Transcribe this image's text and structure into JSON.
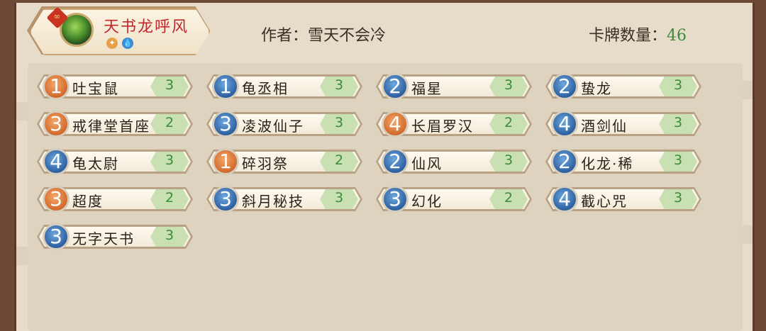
{
  "deck": {
    "name": "天书龙呼风",
    "corner_icon": "link-icon",
    "elements": [
      "fire-element-icon",
      "water-element-icon"
    ]
  },
  "author": {
    "label": "作者：雪天不会冷"
  },
  "card_count": {
    "label": "卡牌数量：",
    "value": "46"
  },
  "colors": {
    "cost_orange": "#d06a2c",
    "cost_blue": "#2d5f9f",
    "count_green": "#3d8a3a",
    "deck_name_red": "#c0282c"
  },
  "cards": [
    {
      "cost": "1",
      "color": "orange",
      "name": "吐宝鼠",
      "count": "3"
    },
    {
      "cost": "1",
      "color": "blue",
      "name": "龟丞相",
      "count": "3"
    },
    {
      "cost": "2",
      "color": "blue",
      "name": "福星",
      "count": "3"
    },
    {
      "cost": "2",
      "color": "blue",
      "name": "蛰龙",
      "count": "3"
    },
    {
      "cost": "3",
      "color": "orange",
      "name": "戒律堂首座",
      "count": "2"
    },
    {
      "cost": "3",
      "color": "blue",
      "name": "凌波仙子",
      "count": "3"
    },
    {
      "cost": "4",
      "color": "orange",
      "name": "长眉罗汉",
      "count": "2"
    },
    {
      "cost": "4",
      "color": "blue",
      "name": "酒剑仙",
      "count": "3"
    },
    {
      "cost": "4",
      "color": "blue",
      "name": "龟太尉",
      "count": "3"
    },
    {
      "cost": "1",
      "color": "orange",
      "name": "碎羽祭",
      "count": "2"
    },
    {
      "cost": "2",
      "color": "blue",
      "name": "仙风",
      "count": "3"
    },
    {
      "cost": "2",
      "color": "blue",
      "name": "化龙·稀",
      "count": "3"
    },
    {
      "cost": "3",
      "color": "orange",
      "name": "超度",
      "count": "2"
    },
    {
      "cost": "3",
      "color": "blue",
      "name": "斜月秘技",
      "count": "3"
    },
    {
      "cost": "3",
      "color": "blue",
      "name": "幻化",
      "count": "2"
    },
    {
      "cost": "4",
      "color": "blue",
      "name": "截心咒",
      "count": "3"
    },
    {
      "cost": "3",
      "color": "blue",
      "name": "无字天书",
      "count": "3"
    }
  ]
}
